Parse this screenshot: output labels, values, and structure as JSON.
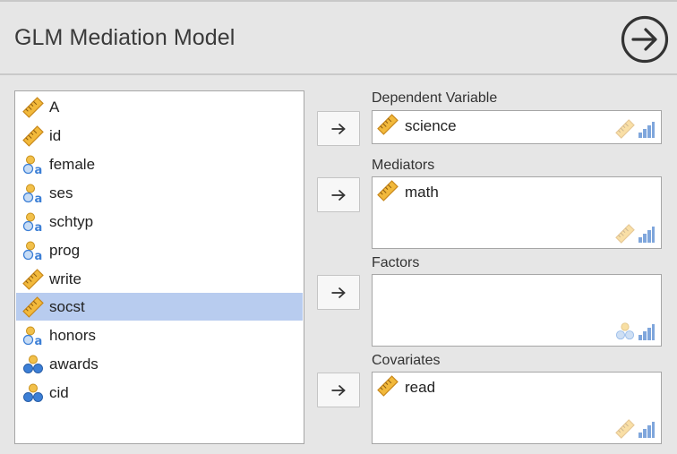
{
  "header": {
    "title": "GLM Mediation Model",
    "run_icon": "arrow-right-circle-icon"
  },
  "variables": [
    {
      "name": "A",
      "type": "continuous"
    },
    {
      "name": "id",
      "type": "continuous"
    },
    {
      "name": "female",
      "type": "nominal-text"
    },
    {
      "name": "ses",
      "type": "nominal-text"
    },
    {
      "name": "schtyp",
      "type": "nominal-text"
    },
    {
      "name": "prog",
      "type": "nominal-text"
    },
    {
      "name": "write",
      "type": "continuous"
    },
    {
      "name": "socst",
      "type": "continuous",
      "selected": true
    },
    {
      "name": "honors",
      "type": "nominal-text"
    },
    {
      "name": "awards",
      "type": "nominal"
    },
    {
      "name": "cid",
      "type": "nominal"
    }
  ],
  "targets": {
    "dependent": {
      "label": "Dependent Variable",
      "items": [
        "science"
      ],
      "accepts": [
        "continuous",
        "ordinal"
      ]
    },
    "mediators": {
      "label": "Mediators",
      "items": [
        "math"
      ],
      "accepts": [
        "continuous",
        "ordinal"
      ]
    },
    "factors": {
      "label": "Factors",
      "items": [],
      "accepts": [
        "nominal",
        "ordinal"
      ]
    },
    "covariates": {
      "label": "Covariates",
      "items": [
        "read"
      ],
      "accepts": [
        "continuous",
        "ordinal"
      ]
    }
  },
  "colors": {
    "ruler": "#f2b93b",
    "ruler_stroke": "#c8871a",
    "nominal_blue": "#3c7fd6",
    "nominal_yellow": "#f2c04a",
    "selection": "#b8ccef",
    "ordinal_bars": "#7fa6dc"
  }
}
